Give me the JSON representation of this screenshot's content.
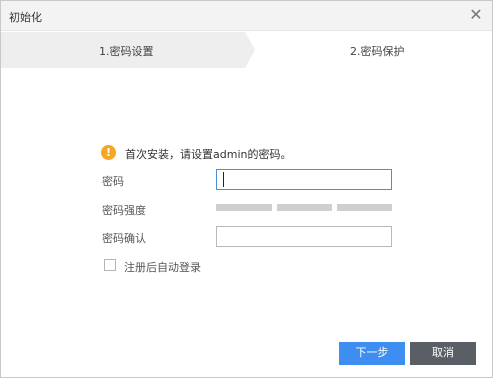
{
  "window": {
    "title": "初始化"
  },
  "icons": {
    "close": "close-icon",
    "warning": "warning-icon",
    "checkbox": "checkbox"
  },
  "steps": [
    {
      "label": "1.密码设置",
      "active": true
    },
    {
      "label": "2.密码保护",
      "active": false
    }
  ],
  "notice": {
    "text": "首次安装，请设置admin的密码。"
  },
  "form": {
    "password_label": "密码",
    "password_value": "",
    "strength_label": "密码强度",
    "strength_level": 0,
    "confirm_label": "密码确认",
    "confirm_value": "",
    "auto_login_label": "注册后自动登录",
    "auto_login_checked": false
  },
  "buttons": {
    "next": "下一步",
    "cancel": "取消"
  },
  "colors": {
    "primary": "#3d8ef0",
    "secondary": "#5a5f66",
    "warning": "#f5a623",
    "active_step_bg": "#eeeeee",
    "strength_empty": "#cfcfcf"
  }
}
